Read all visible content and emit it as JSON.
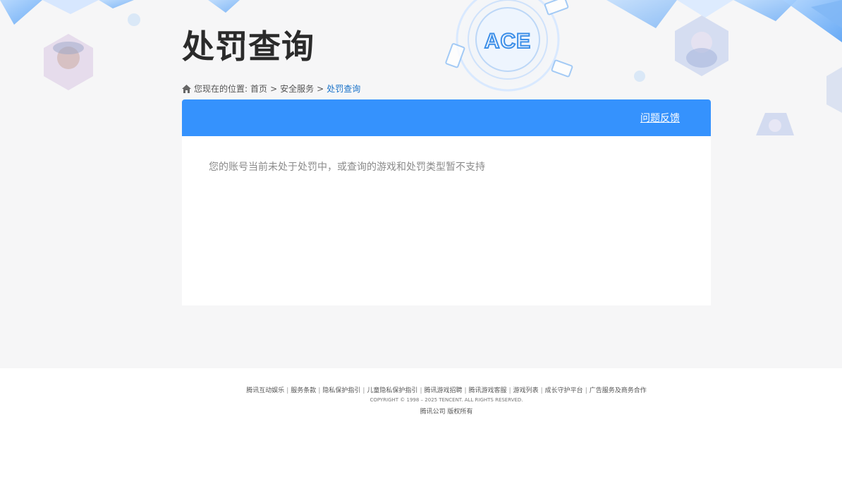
{
  "page": {
    "title": "处罚查询"
  },
  "logo": {
    "text": "ACE"
  },
  "breadcrumb": {
    "prefix": "您现在的位置:",
    "items": [
      "首页",
      "安全服务"
    ],
    "separator": ">",
    "current": "处罚查询"
  },
  "card": {
    "feedback_label": "问题反馈",
    "message": "您的账号当前未处于处罚中，或查询的游戏和处罚类型暂不支持"
  },
  "footer": {
    "links": [
      "腾讯互动娱乐",
      "服务条款",
      "隐私保护指引",
      "儿童隐私保护指引",
      "腾讯游戏招聘",
      "腾讯游戏客服",
      "游戏列表",
      "成长守护平台",
      "广告服务及商务合作"
    ],
    "copyright": "COPYRIGHT © 1998 – 2025 TENCENT. ALL RIGHTS RESERVED.",
    "company": "腾讯公司 版权所有"
  },
  "colors": {
    "header_blue": "#3592fd",
    "page_bg": "#f6f6f7",
    "breadcrumb_current": "#1a73c9"
  }
}
